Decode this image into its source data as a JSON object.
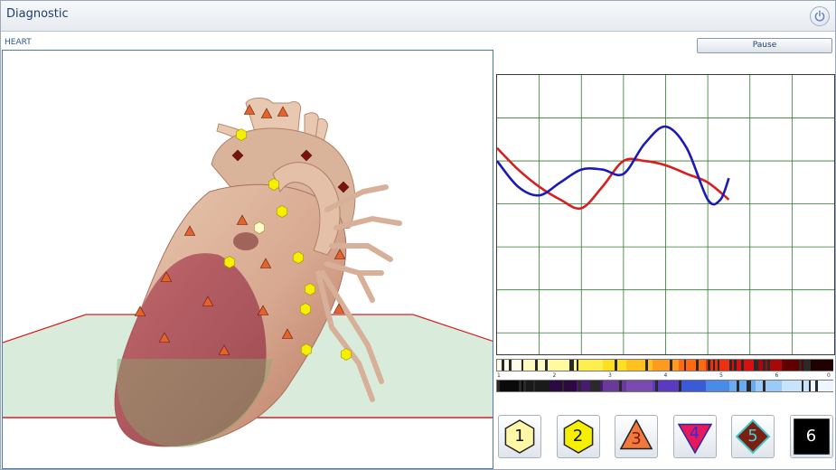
{
  "window": {
    "title": "Diagnostic"
  },
  "section_label": "HEART",
  "pause_label": "Pause",
  "scale_numbers": [
    "1",
    "2",
    "3",
    "4",
    "5",
    "6",
    "0"
  ],
  "level_buttons": [
    {
      "label": "1",
      "shape": "hexagon",
      "fill": "#fff7a8",
      "stroke": "#222222",
      "text_color": "#111111"
    },
    {
      "label": "2",
      "shape": "hexagon",
      "fill": "#f4f000",
      "stroke": "#222222",
      "text_color": "#111111"
    },
    {
      "label": "3",
      "shape": "triangle-up",
      "fill": "#f07a3c",
      "stroke": "#222222",
      "text_color": "#7a1a10"
    },
    {
      "label": "4",
      "shape": "triangle-down",
      "fill": "#e8185c",
      "stroke": "#2a2aa0",
      "text_color": "#3a2ad0"
    },
    {
      "label": "5",
      "shape": "diamond",
      "fill": "#7a1f12",
      "stroke": "#40c8c8",
      "text_color": "#40d0d0"
    },
    {
      "label": "6",
      "shape": "square",
      "fill": "#000000",
      "stroke": "#000000",
      "text_color": "#ffffff"
    }
  ],
  "chart_data": {
    "type": "line",
    "grid": true,
    "xlim": [
      0,
      8
    ],
    "ylim": [
      0,
      6.5
    ],
    "series": [
      {
        "color": "#d81e1e",
        "x": [
          0,
          0.5,
          1,
          1.5,
          2,
          2.5,
          3,
          3.5,
          4,
          4.5,
          5,
          5.5
        ],
        "y": [
          4.8,
          4.3,
          3.9,
          3.6,
          3.4,
          3.9,
          4.5,
          4.5,
          4.4,
          4.2,
          4.0,
          3.6
        ]
      },
      {
        "color": "#1a1ab8",
        "x": [
          0,
          0.5,
          1,
          1.5,
          2,
          2.5,
          3,
          3.5,
          4,
          4.5,
          5,
          5.3,
          5.5
        ],
        "y": [
          4.5,
          3.9,
          3.7,
          4.0,
          4.3,
          4.3,
          4.2,
          4.9,
          5.3,
          4.8,
          3.6,
          3.6,
          4.1
        ]
      }
    ],
    "points": [
      {
        "marker": "triangle",
        "color": "#e5632a",
        "x": 274,
        "y": 120
      },
      {
        "marker": "triangle",
        "color": "#e5632a",
        "x": 293,
        "y": 124
      },
      {
        "marker": "triangle",
        "color": "#e5632a",
        "x": 311,
        "y": 122
      },
      {
        "marker": "hexagon",
        "color": "#f4f000",
        "x": 265,
        "y": 147
      },
      {
        "marker": "diamond",
        "color": "#7a1212",
        "x": 261,
        "y": 170
      },
      {
        "marker": "diamond",
        "color": "#7a1212",
        "x": 337,
        "y": 170
      },
      {
        "marker": "diamond",
        "color": "#7a1212",
        "x": 378,
        "y": 205
      },
      {
        "marker": "hexagon",
        "color": "#f4f000",
        "x": 301,
        "y": 202
      },
      {
        "marker": "hexagon",
        "color": "#f4f000",
        "x": 310,
        "y": 232
      },
      {
        "marker": "triangle",
        "color": "#e5632a",
        "x": 266,
        "y": 242
      },
      {
        "marker": "hexagon",
        "color": "#fffbd0",
        "x": 285,
        "y": 250
      },
      {
        "marker": "triangle",
        "color": "#e5632a",
        "x": 208,
        "y": 254
      },
      {
        "marker": "hexagon",
        "color": "#f4f000",
        "x": 252,
        "y": 288
      },
      {
        "marker": "triangle",
        "color": "#e5632a",
        "x": 292,
        "y": 290
      },
      {
        "marker": "hexagon",
        "color": "#f4f000",
        "x": 328,
        "y": 283
      },
      {
        "marker": "triangle",
        "color": "#e5632a",
        "x": 374,
        "y": 280
      },
      {
        "marker": "triangle",
        "color": "#e5632a",
        "x": 182,
        "y": 305
      },
      {
        "marker": "hexagon",
        "color": "#f4f000",
        "x": 341,
        "y": 318
      },
      {
        "marker": "triangle",
        "color": "#e5632a",
        "x": 228,
        "y": 332
      },
      {
        "marker": "triangle",
        "color": "#e5632a",
        "x": 153,
        "y": 343
      },
      {
        "marker": "hexagon",
        "color": "#f4f000",
        "x": 336,
        "y": 340
      },
      {
        "marker": "triangle",
        "color": "#e5632a",
        "x": 289,
        "y": 342
      },
      {
        "marker": "triangle",
        "color": "#e5632a",
        "x": 373,
        "y": 340
      },
      {
        "marker": "triangle",
        "color": "#e5632a",
        "x": 180,
        "y": 372
      },
      {
        "marker": "triangle",
        "color": "#e5632a",
        "x": 316,
        "y": 368
      },
      {
        "marker": "hexagon",
        "color": "#f4f000",
        "x": 337,
        "y": 385
      },
      {
        "marker": "triangle",
        "color": "#e5632a",
        "x": 246,
        "y": 386
      },
      {
        "marker": "hexagon",
        "color": "#f4f000",
        "x": 381,
        "y": 390
      }
    ]
  }
}
